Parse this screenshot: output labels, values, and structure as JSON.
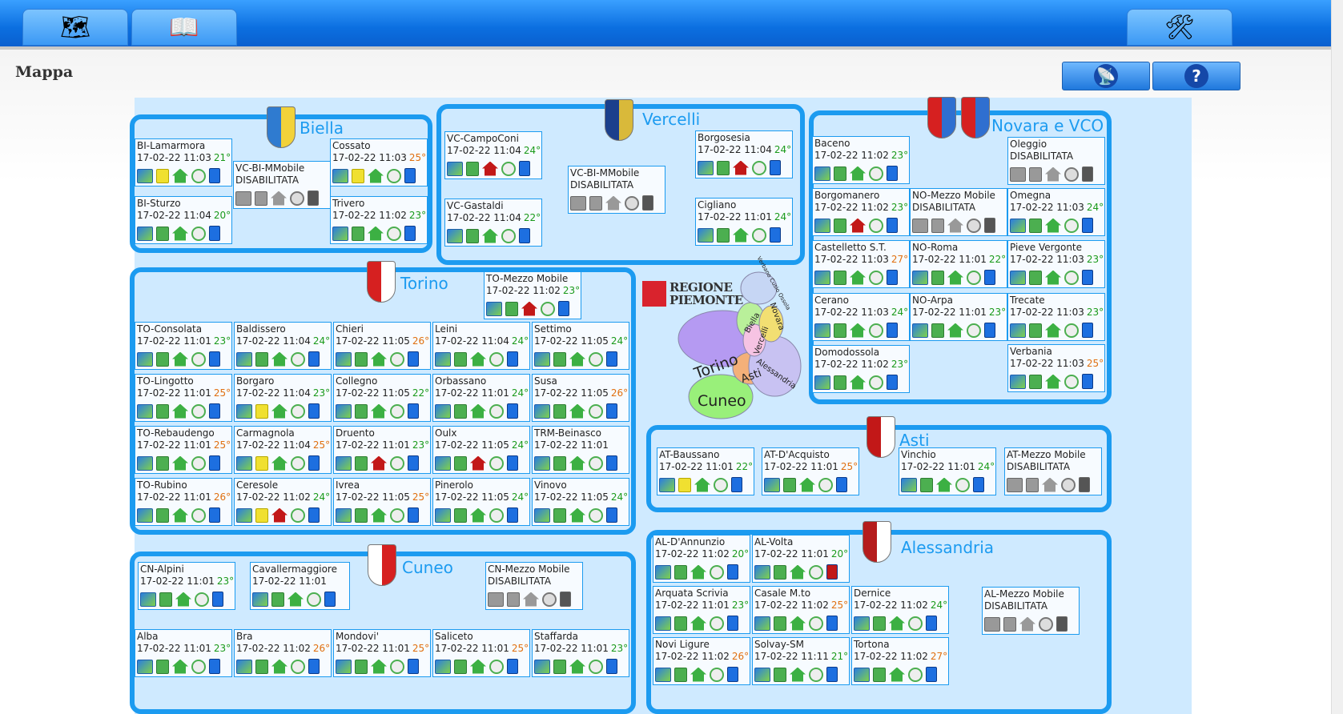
{
  "page": {
    "title": "Mappa"
  },
  "toolbar": {
    "left_icons": [
      "map-search-icon",
      "book-search-icon"
    ],
    "right_icon": "tools-icon"
  },
  "side_buttons": [
    {
      "icon": "antenna-icon"
    },
    {
      "icon": "help-icon",
      "label": "?"
    }
  ],
  "regione": {
    "line1": "REGIONE",
    "line2": "PIEMONTE"
  },
  "regione_map_labels": [
    "Verbano Cusio Ossola",
    "Novara",
    "Biella",
    "Vercelli",
    "Torino",
    "Asti",
    "Alessandria",
    "Cuneo"
  ],
  "provinces": [
    {
      "name": "Biella",
      "stations": [
        {
          "name": "BI-Lamarmora",
          "date": "17-02-22 11:03",
          "temp": "21°",
          "tc": "g"
        },
        {
          "name": "VC-BI-MMobile",
          "status": "DISABILITATA"
        },
        {
          "name": "Cossato",
          "date": "17-02-22 11:03",
          "temp": "25°",
          "tc": "o"
        },
        {
          "name": "BI-Sturzo",
          "date": "17-02-22 11:04",
          "temp": "20°",
          "tc": "g"
        },
        {
          "name": "Trivero",
          "date": "17-02-22 11:02",
          "temp": "23°",
          "tc": "g"
        }
      ]
    },
    {
      "name": "Vercelli",
      "stations": [
        {
          "name": "VC-CampoConi",
          "date": "17-02-22 11:04",
          "temp": "24°",
          "tc": "g"
        },
        {
          "name": "Borgosesia",
          "date": "17-02-22 11:04",
          "temp": "24°",
          "tc": "g"
        },
        {
          "name": "VC-BI-MMobile",
          "status": "DISABILITATA"
        },
        {
          "name": "VC-Gastaldi",
          "date": "17-02-22 11:04",
          "temp": "22°",
          "tc": "g"
        },
        {
          "name": "Cigliano",
          "date": "17-02-22 11:01",
          "temp": "24°",
          "tc": "g"
        }
      ]
    },
    {
      "name": "Novara e VCO",
      "stations": [
        {
          "name": "Baceno",
          "date": "17-02-22 11:02",
          "temp": "23°",
          "tc": "g"
        },
        {
          "name": "Oleggio",
          "status": "DISABILITATA"
        },
        {
          "name": "Borgomanero",
          "date": "17-02-22 11:02",
          "temp": "23°",
          "tc": "g"
        },
        {
          "name": "NO-Mezzo Mobile",
          "status": "DISABILITATA"
        },
        {
          "name": "Omegna",
          "date": "17-02-22 11:03",
          "temp": "24°",
          "tc": "g"
        },
        {
          "name": "Castelletto S.T.",
          "date": "17-02-22 11:03",
          "temp": "27°",
          "tc": "o"
        },
        {
          "name": "NO-Roma",
          "date": "17-02-22 11:01",
          "temp": "22°",
          "tc": "g"
        },
        {
          "name": "Pieve Vergonte",
          "date": "17-02-22 11:03",
          "temp": "23°",
          "tc": "g"
        },
        {
          "name": "Cerano",
          "date": "17-02-22 11:03",
          "temp": "24°",
          "tc": "g"
        },
        {
          "name": "NO-Arpa",
          "date": "17-02-22 11:01",
          "temp": "23°",
          "tc": "g"
        },
        {
          "name": "Trecate",
          "date": "17-02-22 11:03",
          "temp": "23°",
          "tc": "g"
        },
        {
          "name": "Domodossola",
          "date": "17-02-22 11:02",
          "temp": "23°",
          "tc": "g"
        },
        {
          "name": "Verbania",
          "date": "17-02-22 11:03",
          "temp": "25°",
          "tc": "o"
        }
      ]
    },
    {
      "name": "Torino",
      "stations": [
        {
          "name": "TO-Mezzo Mobile",
          "date": "17-02-22 11:02",
          "temp": "23°",
          "tc": "g"
        },
        {
          "name": "TO-Consolata",
          "date": "17-02-22 11:01",
          "temp": "23°",
          "tc": "g"
        },
        {
          "name": "Baldissero",
          "date": "17-02-22 11:04",
          "temp": "24°",
          "tc": "g"
        },
        {
          "name": "Chieri",
          "date": "17-02-22 11:05",
          "temp": "26°",
          "tc": "o"
        },
        {
          "name": "Leini",
          "date": "17-02-22 11:04",
          "temp": "24°",
          "tc": "g"
        },
        {
          "name": "Settimo",
          "date": "17-02-22 11:05",
          "temp": "24°",
          "tc": "g"
        },
        {
          "name": "TO-Lingotto",
          "date": "17-02-22 11:01",
          "temp": "25°",
          "tc": "o"
        },
        {
          "name": "Borgaro",
          "date": "17-02-22 11:04",
          "temp": "23°",
          "tc": "g"
        },
        {
          "name": "Collegno",
          "date": "17-02-22 11:05",
          "temp": "22°",
          "tc": "g"
        },
        {
          "name": "Orbassano",
          "date": "17-02-22 11:01",
          "temp": "24°",
          "tc": "g"
        },
        {
          "name": "Susa",
          "date": "17-02-22 11:05",
          "temp": "26°",
          "tc": "o"
        },
        {
          "name": "TO-Rebaudengo",
          "date": "17-02-22 11:01",
          "temp": "25°",
          "tc": "o"
        },
        {
          "name": "Carmagnola",
          "date": "17-02-22 11:04",
          "temp": "25°",
          "tc": "o"
        },
        {
          "name": "Druento",
          "date": "17-02-22 11:01",
          "temp": "23°",
          "tc": "g"
        },
        {
          "name": "Oulx",
          "date": "17-02-22 11:05",
          "temp": "24°",
          "tc": "g"
        },
        {
          "name": "TRM-Beinasco",
          "date": "17-02-22 11:01",
          "temp": "",
          "tc": "d"
        },
        {
          "name": "TO-Rubino",
          "date": "17-02-22 11:01",
          "temp": "26°",
          "tc": "o"
        },
        {
          "name": "Ceresole",
          "date": "17-02-22 11:02",
          "temp": "24°",
          "tc": "g"
        },
        {
          "name": "Ivrea",
          "date": "17-02-22 11:05",
          "temp": "25°",
          "tc": "o"
        },
        {
          "name": "Pinerolo",
          "date": "17-02-22 11:05",
          "temp": "24°",
          "tc": "g"
        },
        {
          "name": "Vinovo",
          "date": "17-02-22 11:05",
          "temp": "24°",
          "tc": "g"
        }
      ]
    },
    {
      "name": "Asti",
      "stations": [
        {
          "name": "AT-Baussano",
          "date": "17-02-22 11:01",
          "temp": "22°",
          "tc": "g"
        },
        {
          "name": "AT-D'Acquisto",
          "date": "17-02-22 11:01",
          "temp": "25°",
          "tc": "o"
        },
        {
          "name": "Vinchio",
          "date": "17-02-22 11:01",
          "temp": "24°",
          "tc": "g"
        },
        {
          "name": "AT-Mezzo Mobile",
          "status": "DISABILITATA"
        }
      ]
    },
    {
      "name": "Cuneo",
      "stations": [
        {
          "name": "CN-Alpini",
          "date": "17-02-22 11:01",
          "temp": "23°",
          "tc": "g"
        },
        {
          "name": "Cavallermaggiore",
          "date": "17-02-22 11:01",
          "temp": "",
          "tc": "d"
        },
        {
          "name": "CN-Mezzo Mobile",
          "status": "DISABILITATA"
        },
        {
          "name": "Alba",
          "date": "17-02-22 11:01",
          "temp": "23°",
          "tc": "g"
        },
        {
          "name": "Bra",
          "date": "17-02-22 11:02",
          "temp": "26°",
          "tc": "o"
        },
        {
          "name": "Mondovi'",
          "date": "17-02-22 11:01",
          "temp": "25°",
          "tc": "o"
        },
        {
          "name": "Saliceto",
          "date": "17-02-22 11:01",
          "temp": "25°",
          "tc": "o"
        },
        {
          "name": "Staffarda",
          "date": "17-02-22 11:01",
          "temp": "23°",
          "tc": "g"
        }
      ]
    },
    {
      "name": "Alessandria",
      "stations": [
        {
          "name": "AL-D'Annunzio",
          "date": "17-02-22 11:02",
          "temp": "20°",
          "tc": "g"
        },
        {
          "name": "AL-Volta",
          "date": "17-02-22 11:01",
          "temp": "20°",
          "tc": "g"
        },
        {
          "name": "Arquata Scrivia",
          "date": "17-02-22 11:01",
          "temp": "23°",
          "tc": "g"
        },
        {
          "name": "Casale M.to",
          "date": "17-02-22 11:02",
          "temp": "25°",
          "tc": "o"
        },
        {
          "name": "Dernice",
          "date": "17-02-22 11:02",
          "temp": "24°",
          "tc": "g"
        },
        {
          "name": "AL-Mezzo Mobile",
          "status": "DISABILITATA"
        },
        {
          "name": "Novi Ligure",
          "date": "17-02-22 11:02",
          "temp": "26°",
          "tc": "o"
        },
        {
          "name": "Solvay-SM",
          "date": "17-02-22 11:11",
          "temp": "21°",
          "tc": "g"
        },
        {
          "name": "Tortona",
          "date": "17-02-22 11:02",
          "temp": "27°",
          "tc": "o"
        }
      ]
    }
  ],
  "colors": {
    "accent": "#1c9bf0",
    "panel": "#cfeaff",
    "temp_ok": "#1a9a1a",
    "temp_warm": "#e07010"
  }
}
